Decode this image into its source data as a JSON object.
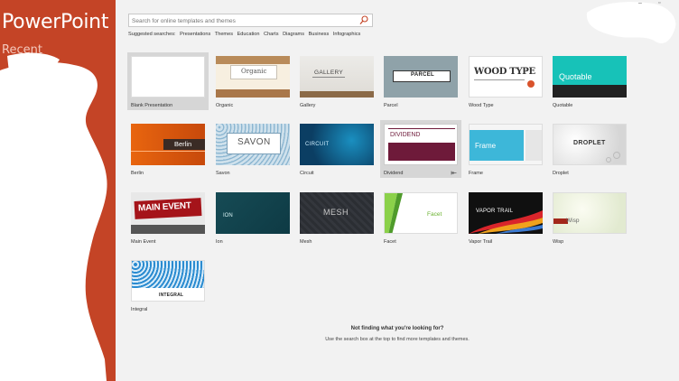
{
  "app": {
    "title": "PowerPoint",
    "recent_label": "Recent"
  },
  "search": {
    "placeholder": "Search for online templates and themes"
  },
  "suggested": {
    "prefix": "Suggested searches:",
    "items": [
      "Presentations",
      "Themes",
      "Education",
      "Charts",
      "Diagrams",
      "Business",
      "Infographics"
    ]
  },
  "templates": [
    {
      "name": "Blank Presentation",
      "thumb_text": ""
    },
    {
      "name": "Organic",
      "thumb_text": "Organic"
    },
    {
      "name": "Gallery",
      "thumb_text": "GALLERY"
    },
    {
      "name": "Parcel",
      "thumb_text": "PARCEL"
    },
    {
      "name": "Wood Type",
      "thumb_text": "WOOD TYPE"
    },
    {
      "name": "Quotable",
      "thumb_text": "Quotable"
    },
    {
      "name": "Berlin",
      "thumb_text": "Berlin"
    },
    {
      "name": "Savon",
      "thumb_text": "SAVON"
    },
    {
      "name": "Circuit",
      "thumb_text": "CIRCUIT"
    },
    {
      "name": "Dividend",
      "thumb_text": "DIVIDEND"
    },
    {
      "name": "Frame",
      "thumb_text": "Frame"
    },
    {
      "name": "Droplet",
      "thumb_text": "DROPLET"
    },
    {
      "name": "Main Event",
      "thumb_text": "MAIN EVENT"
    },
    {
      "name": "Ion",
      "thumb_text": "ION"
    },
    {
      "name": "Mesh",
      "thumb_text": "MESH"
    },
    {
      "name": "Facet",
      "thumb_text": "Facet"
    },
    {
      "name": "Vapor Trail",
      "thumb_text": "VAPOR TRAIL"
    },
    {
      "name": "Wisp",
      "thumb_text": "Wisp"
    },
    {
      "name": "Integral",
      "thumb_text": "INTEGRAL"
    }
  ],
  "footer": {
    "title": "Not finding what you're looking for?",
    "subtitle": "Use the search box at the top to find more templates and themes."
  },
  "window_controls": {
    "minimize": "–",
    "restore": "▫"
  },
  "colors": {
    "accent": "#c44426",
    "background": "#f2f2f2"
  },
  "icons": [
    "search-icon",
    "pin-icon"
  ]
}
